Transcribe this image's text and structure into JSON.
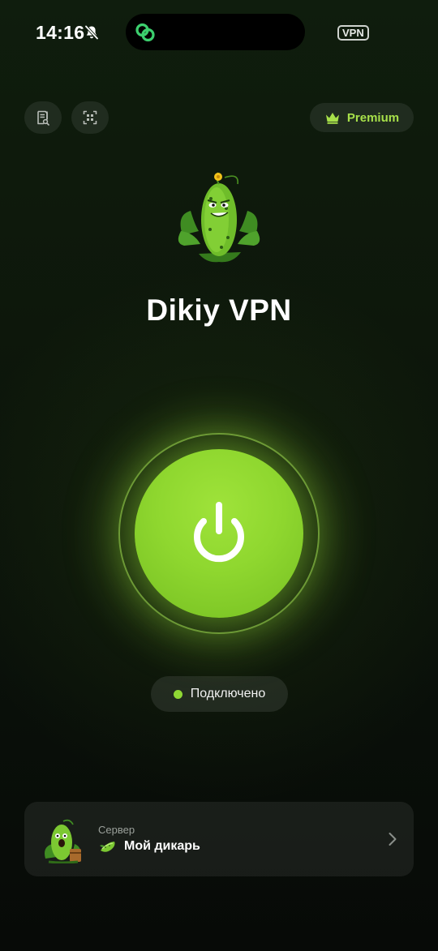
{
  "status_bar": {
    "time": "14:16",
    "vpn_badge": "VPN",
    "icons": [
      "bell-off-icon",
      "chain-link-icon"
    ]
  },
  "top_bar": {
    "left_icons": [
      "log-search-icon",
      "scan-icon"
    ],
    "premium_label": "Premium",
    "premium_icon": "crown-icon"
  },
  "app": {
    "title": "Dikiy VPN",
    "mascot": "cucumber-mascot"
  },
  "connection": {
    "button_icon": "power-icon",
    "status_text": "Подключено",
    "status_color": "#8fd834"
  },
  "server": {
    "caption": "Сервер",
    "name": "Мой дикарь",
    "icon": "cucumber-icon"
  },
  "colors": {
    "accent": "#8fd834",
    "premium": "#a7e04a",
    "background": "#0d170b"
  }
}
